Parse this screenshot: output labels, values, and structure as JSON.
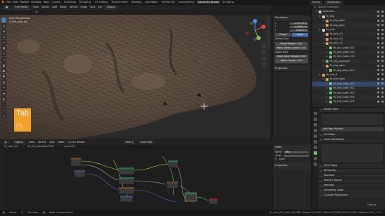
{
  "topbar": {
    "menus": [
      "File",
      "Edit",
      "Render",
      "Window",
      "Help"
    ],
    "workspaces": [
      "Layout",
      "Modeling",
      "Sculpting",
      "UV Editing",
      "Texture Paint",
      "Shading",
      "Animation",
      "Rendering",
      "Compositing",
      "Geometry Nodes",
      "Scripting"
    ],
    "active_workspace": "Geometry Nodes",
    "scene": "Scene",
    "view_layer": "ViewLayer"
  },
  "viewport": {
    "mode": "Edit Mode",
    "header_items": [
      "View",
      "Select",
      "Add",
      "Mesh",
      "Vertex",
      "Edge",
      "Face",
      "UV"
    ],
    "transform": "Global",
    "overlay_title": "User Perspective",
    "overlay_object": "(1) fit_rock_02",
    "tab_key": "Tab",
    "colors": {
      "mesh": "#5e4d3f",
      "wire": "#2d2a27",
      "accent": "#4772b3",
      "tab": "#f2a12b"
    }
  },
  "npanel": {
    "section": "Transform",
    "values": [
      {
        "label": "X",
        "value": "-0.07133 m"
      },
      {
        "label": "Y",
        "value": "-0.09831 m"
      },
      {
        "label": "Z",
        "value": "0.0624 m"
      }
    ],
    "toggle": [
      "Global",
      "Local"
    ],
    "vertex_data_label": "Vertex Data:",
    "vertex_rows": [
      "Bevel Weight: 0.00",
      "Mean Vertex Crease: 0.00"
    ],
    "edge_data_label": "Edges Data:",
    "edge_rows": [
      "Mean Bevel Weight: 0.00",
      "Mean Crease: 0.00"
    ],
    "properties_label": "Properties"
  },
  "outliner": {
    "header": "Scene Collection",
    "rows": [
      {
        "label": "Collection",
        "icon": "collection-icon",
        "color": "#cccccc"
      },
      {
        "label": "fit_bkg",
        "icon": "collection-icon",
        "color": "#cccccc"
      },
      {
        "label": "fit_bkg_bake",
        "icon": "object-icon",
        "color": "#e39b4f"
      },
      {
        "label": "fit_bkg_bake",
        "icon": "object-icon",
        "color": "#e39b4f"
      },
      {
        "label": "fit_rock",
        "icon": "collection-icon",
        "color": "#cccccc"
      },
      {
        "label": "fit_rock_01",
        "icon": "object-icon",
        "color": "#e39b4f"
      },
      {
        "label": "fit_rock_02",
        "icon": "object-icon",
        "color": "#e39b4f"
      },
      {
        "label": "fit_rock_03",
        "icon": "object-icon",
        "color": "#e39b4f"
      },
      {
        "label": "fit_rock_bake_001",
        "icon": "mesh-icon",
        "color": "#6bc16b"
      },
      {
        "label": "fit_rock_bake_002",
        "icon": "mesh-icon",
        "color": "#6bc16b"
      },
      {
        "label": "fit_rock_bake_003",
        "icon": "mesh-icon",
        "color": "#6bc16b"
      },
      {
        "label": "fit_bkg_geometry",
        "icon": "mesh-icon",
        "color": "#6bc16b"
      },
      {
        "label": "fit_bkg_bake",
        "icon": "object-icon",
        "color": "#e39b4f"
      },
      {
        "label": "fit_bkg_bake_001",
        "icon": "mesh-icon",
        "color": "#6bc16b"
      },
      {
        "label": "fit_tree_1",
        "icon": "object-icon",
        "color": "#e39b4f"
      },
      {
        "label": "fit_tree_bake",
        "icon": "object-icon",
        "color": "#e39b4f"
      },
      {
        "label": "fit_tree_bake_001",
        "icon": "mesh-icon",
        "color": "#6bc16b"
      },
      {
        "label": "fit_tree_bake_002",
        "icon": "mesh-icon",
        "color": "#6bc16b"
      },
      {
        "label": "fit_tree_bake_003",
        "icon": "mesh-icon",
        "color": "#6bc16b"
      },
      {
        "label": "fit_tree_bake_004",
        "icon": "mesh-icon",
        "color": "#6bc16b"
      },
      {
        "label": "fit_tree_bake_005",
        "icon": "mesh-icon",
        "color": "#6bc16b"
      }
    ],
    "selected_index": 16
  },
  "properties": {
    "sections": {
      "shape_keys": "Shape Keys",
      "add_rest": "Add Rest Position",
      "uv_maps": "UV Maps",
      "color_attributes": "Color Attributes",
      "face_maps": "Face Maps",
      "attributes": "Attributes",
      "normals": "Normals",
      "texture_space": "Texture Space",
      "remesh": "Remesh",
      "geometry_data": "Geometry Data",
      "custom_properties": "Custom Properties"
    }
  },
  "node_editor": {
    "editor_type": "Object",
    "header_items": [
      "View",
      "Select",
      "Add",
      "Node"
    ],
    "use_nodes": "Use Nodes",
    "slot": "Slot 1",
    "material": "bark.001",
    "breadcrumb": [
      "fit_rock_02",
      "fit_02_caesalpini.001",
      "bark.001"
    ],
    "npanel_section": "Node",
    "name_label": "Name:",
    "name_value": "Mix",
    "label_label": "Label:",
    "color_label": "Color",
    "properties_label": "Properties"
  },
  "statusbar": {
    "items": [
      "Select",
      "Pan View",
      "Node Context Menu"
    ],
    "right": "fit_rock_02 | Verts 0/5,368 | Edges 0/10,623 | Faces 0/5,258 | Tris 10,516 | Objects 1/27 | 3.4.1"
  },
  "watermark": "Udemy"
}
